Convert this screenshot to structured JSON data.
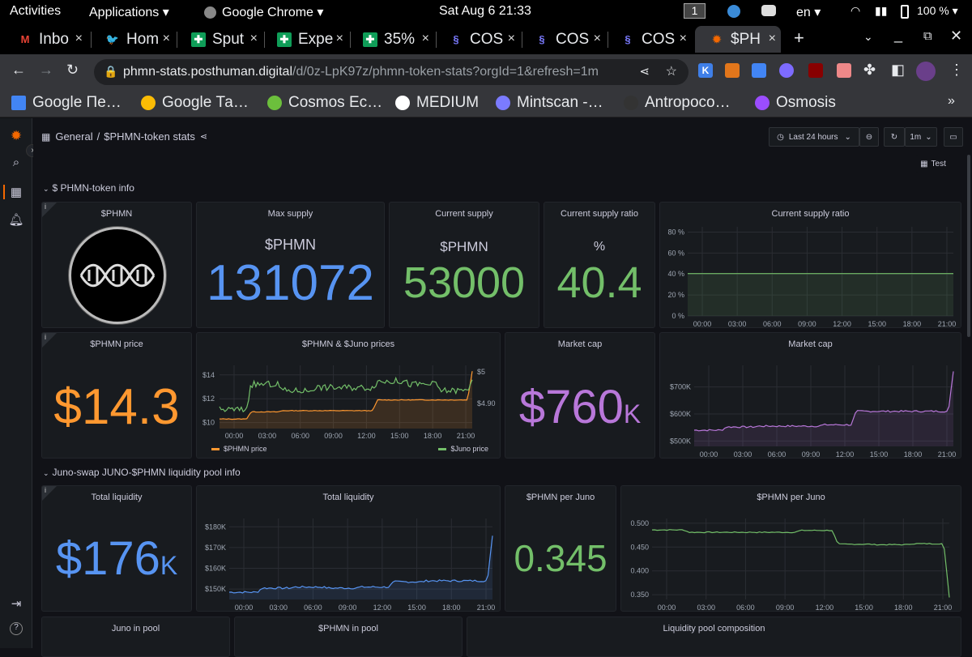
{
  "os_bar": {
    "activities": "Activities",
    "applications": "Applications ▾",
    "chrome": "Google Chrome ▾",
    "clock": "Sat Aug 6  21:33",
    "workspace": "1",
    "lang": "en ▾",
    "battery": "100 % ▾"
  },
  "tabs": [
    {
      "label": "Inbo",
      "icon": "gmail-icon",
      "color": "#ea4335"
    },
    {
      "label": "Hom",
      "icon": "twitter-icon",
      "color": "#1da1f2"
    },
    {
      "label": "Sput",
      "icon": "sheets-icon",
      "color": "#0f9d58"
    },
    {
      "label": "Expe",
      "icon": "sheets-icon",
      "color": "#0f9d58"
    },
    {
      "label": "35%",
      "icon": "sheets-icon",
      "color": "#0f9d58"
    },
    {
      "label": "COS",
      "icon": "cosmos-icon",
      "color": "#7b7bff"
    },
    {
      "label": "COS",
      "icon": "cosmos-icon",
      "color": "#7b7bff"
    },
    {
      "label": "COS",
      "icon": "cosmos-icon",
      "color": "#7b7bff"
    },
    {
      "label": "$PH",
      "icon": "grafana-icon",
      "color": "#f46800"
    }
  ],
  "url": {
    "host": "phmn-stats.posthuman.digital",
    "path": "/d/0z-LpK97z/phmn-token-stats?orgId=1&refresh=1m"
  },
  "bookmarks": [
    {
      "label": "Google Пе…",
      "color": "#4285f4"
    },
    {
      "label": "Google Та…",
      "color": "#fbbc05"
    },
    {
      "label": "Cosmos Ec…",
      "color": "#6cbf3c"
    },
    {
      "label": "MEDIUM",
      "color": "#ffffff"
    },
    {
      "label": "Mintscan -…",
      "color": "#7b7bff"
    },
    {
      "label": "Antropoco…",
      "color": "#333333"
    },
    {
      "label": "Osmosis",
      "color": "#9b4dff"
    }
  ],
  "dashboard": {
    "breadcrumb_folder": "General",
    "breadcrumb_sep": "/",
    "breadcrumb_title": "$PHMN-token stats",
    "time_range": "Last 24 hours",
    "refresh": "1m",
    "test_button": "Test",
    "row1_title": "$ PHMN-token info",
    "row2_title": "Juno-swap JUNO-$PHMN liquidity pool info"
  },
  "panels": {
    "logo": {
      "title": "$PHMN"
    },
    "max_supply": {
      "title": "Max supply",
      "unit": "$PHMN",
      "value": "131072",
      "color": "#5794f2"
    },
    "current_supply": {
      "title": "Current supply",
      "unit": "$PHMN",
      "value": "53000",
      "color": "#73bf69"
    },
    "supply_ratio": {
      "title": "Current supply ratio",
      "unit": "%",
      "value": "40.4",
      "color": "#73bf69"
    },
    "supply_ratio_chart": {
      "title": "Current supply ratio"
    },
    "price": {
      "title": "$PHMN price",
      "value": "$14.3",
      "color": "#ff9830"
    },
    "prices_chart": {
      "title": "$PHMN & $Juno prices",
      "legend_phmn": "$PHMN price",
      "legend_juno": "$Juno price"
    },
    "market_cap": {
      "title": "Market cap",
      "value": "$760",
      "suffix": "K",
      "color": "#b877d9"
    },
    "market_cap_chart": {
      "title": "Market cap"
    },
    "total_liquidity": {
      "title": "Total liquidity",
      "value": "$176",
      "suffix": "K",
      "color": "#5794f2"
    },
    "total_liquidity_chart": {
      "title": "Total liquidity"
    },
    "phmn_per_juno": {
      "title": "$PHMN per Juno",
      "value": "0.345",
      "color": "#73bf69"
    },
    "phmn_per_juno_chart": {
      "title": "$PHMN per Juno"
    },
    "juno_in_pool": {
      "title": "Juno in pool"
    },
    "phmn_in_pool": {
      "title": "$PHMN in pool"
    },
    "pool_composition": {
      "title": "Liquidity pool composition"
    }
  },
  "chart_data": [
    {
      "type": "area",
      "title": "Current supply ratio",
      "x": [
        "00:00",
        "03:00",
        "06:00",
        "09:00",
        "12:00",
        "15:00",
        "18:00",
        "21:00"
      ],
      "yticks": [
        "0 %",
        "20 %",
        "40 %",
        "60 %",
        "80 %"
      ],
      "ylim": [
        0,
        85
      ],
      "series": [
        {
          "values": [
            40.4,
            40.4,
            40.4,
            40.4,
            40.4,
            40.4,
            40.4,
            40.4
          ],
          "color": "#73bf69"
        }
      ]
    },
    {
      "type": "line",
      "title": "$PHMN & $Juno prices",
      "x": [
        "00:00",
        "03:00",
        "06:00",
        "09:00",
        "12:00",
        "15:00",
        "18:00",
        "21:00"
      ],
      "yticks_left": [
        "$10",
        "$12",
        "$14"
      ],
      "yticks_right": [
        "$4.90",
        "$5"
      ],
      "series": [
        {
          "name": "$PHMN price",
          "axis": "left",
          "color": "#ff9830",
          "values": [
            10.3,
            10.9,
            11.0,
            11.0,
            11.0,
            11.9,
            11.9,
            11.9,
            14.3
          ]
        },
        {
          "name": "$Juno price",
          "axis": "right",
          "color": "#73bf69",
          "values": [
            4.88,
            4.96,
            4.94,
            4.95,
            4.95,
            4.97,
            4.96,
            4.94,
            4.98
          ]
        }
      ]
    },
    {
      "type": "area",
      "title": "Market cap",
      "x": [
        "00:00",
        "03:00",
        "06:00",
        "09:00",
        "12:00",
        "15:00",
        "18:00",
        "21:00"
      ],
      "yticks": [
        "$500K",
        "$600K",
        "$700K"
      ],
      "ylim": [
        480000,
        780000
      ],
      "series": [
        {
          "color": "#b877d9",
          "values": [
            540000,
            552000,
            555000,
            555000,
            560000,
            610000,
            610000,
            610000,
            760000
          ]
        }
      ]
    },
    {
      "type": "area",
      "title": "Total liquidity",
      "x": [
        "00:00",
        "03:00",
        "06:00",
        "09:00",
        "12:00",
        "15:00",
        "18:00",
        "21:00"
      ],
      "yticks": [
        "$150K",
        "$160K",
        "$170K",
        "$180K"
      ],
      "ylim": [
        145000,
        184000
      ],
      "series": [
        {
          "color": "#5794f2",
          "values": [
            148500,
            150500,
            151000,
            150500,
            151000,
            153500,
            154000,
            154000,
            176000
          ]
        }
      ]
    },
    {
      "type": "line",
      "title": "$PHMN per Juno",
      "x": [
        "00:00",
        "03:00",
        "06:00",
        "09:00",
        "12:00",
        "15:00",
        "18:00",
        "21:00"
      ],
      "yticks": [
        "0.350",
        "0.400",
        "0.450",
        "0.500"
      ],
      "ylim": [
        0.34,
        0.51
      ],
      "series": [
        {
          "color": "#73bf69",
          "values": [
            0.486,
            0.481,
            0.481,
            0.481,
            0.485,
            0.456,
            0.455,
            0.457,
            0.345
          ]
        }
      ]
    }
  ]
}
